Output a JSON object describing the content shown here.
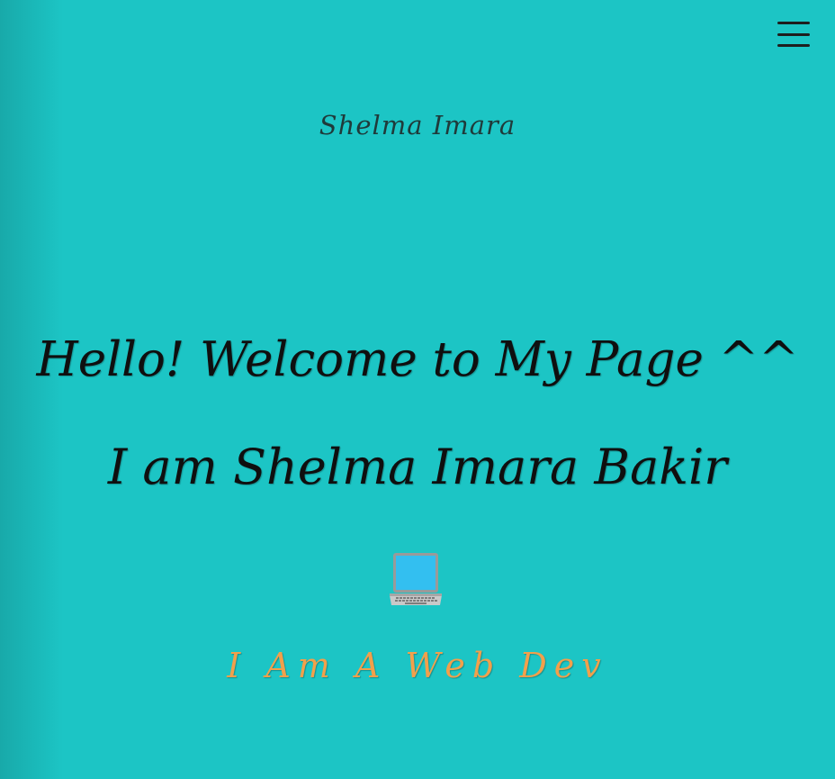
{
  "header": {
    "site_title": "Shelma Imara",
    "menu_icon": "hamburger-menu-icon"
  },
  "hero": {
    "greeting": "Hello! Welcome to My Page ^^",
    "name_line": "I am Shelma Imara Bakir",
    "emoji_icon": "laptop-icon",
    "role_text": "I Am A Web Dev"
  },
  "colors": {
    "background": "#1cc5c5",
    "heading_text": "#0f0f0f",
    "site_title_text": "#1f3a3a",
    "role_text": "#f2a04b",
    "menu_icon": "#1e1e1e"
  }
}
